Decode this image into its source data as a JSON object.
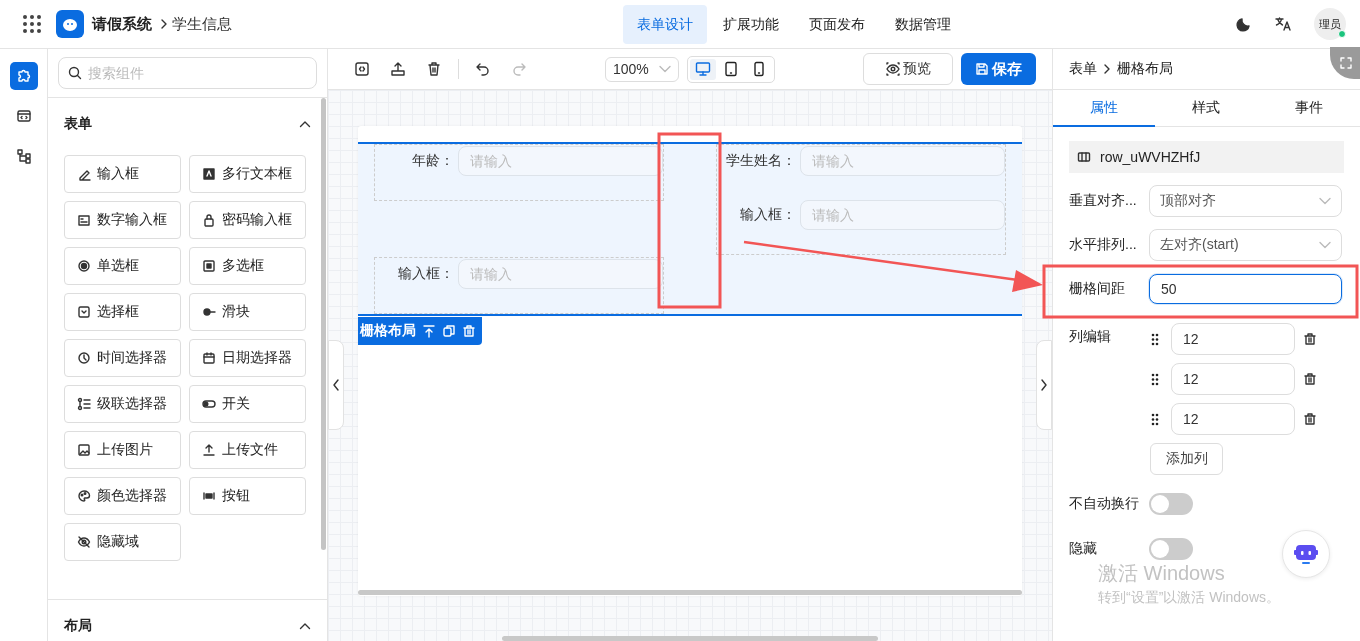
{
  "header": {
    "app_title": "请假系统",
    "breadcrumb": "学生信息",
    "tabs": [
      {
        "label": "表单设计",
        "selected": true
      },
      {
        "label": "扩展功能",
        "selected": false
      },
      {
        "label": "页面发布",
        "selected": false
      },
      {
        "label": "数据管理",
        "selected": false
      }
    ],
    "user": "理员"
  },
  "components": {
    "search": {
      "placeholder": "搜索组件"
    },
    "sections": [
      {
        "title": "表单",
        "expanded": true,
        "items": [
          {
            "label": "输入框"
          },
          {
            "label": "多行文本框"
          },
          {
            "label": "数字输入框"
          },
          {
            "label": "密码输入框"
          },
          {
            "label": "单选框"
          },
          {
            "label": "多选框"
          },
          {
            "label": "选择框"
          },
          {
            "label": "滑块"
          },
          {
            "label": "时间选择器"
          },
          {
            "label": "日期选择器"
          },
          {
            "label": "级联选择器"
          },
          {
            "label": "开关"
          },
          {
            "label": "上传图片"
          },
          {
            "label": "上传文件"
          },
          {
            "label": "颜色选择器"
          },
          {
            "label": "按钮"
          },
          {
            "label": "隐藏域"
          }
        ]
      },
      {
        "title": "布局",
        "expanded": true
      }
    ]
  },
  "toolbar": {
    "zoom": "100%",
    "devices": [
      {
        "kind": "desktop",
        "selected": true
      },
      {
        "kind": "tablet",
        "selected": false
      },
      {
        "kind": "phone",
        "selected": false
      }
    ],
    "preview": "预览",
    "save": "保存"
  },
  "canvas": {
    "grid": {
      "columns": [
        {
          "blocks": [
            {
              "fields": [
                {
                  "label": "年龄：",
                  "placeholder": "请输入"
                }
              ]
            },
            {
              "fields": [
                {
                  "label": "输入框：",
                  "placeholder": "请输入"
                }
              ]
            }
          ]
        },
        {
          "blocks": [
            {
              "fields": [
                {
                  "label": "学生姓名：",
                  "placeholder": "请输入"
                },
                {
                  "label": "输入框：",
                  "placeholder": "请输入"
                }
              ]
            }
          ]
        }
      ],
      "toolbar_label": "栅格布局"
    }
  },
  "properties": {
    "breadcrumb": [
      "表单",
      "栅格布局"
    ],
    "tabs": [
      {
        "label": "属性",
        "selected": true
      },
      {
        "label": "样式",
        "selected": false
      },
      {
        "label": "事件",
        "selected": false
      }
    ],
    "component_id": "row_uWVHZHfJ",
    "rows": [
      {
        "kind": "select",
        "label": "垂直对齐...",
        "value": "顶部对齐"
      },
      {
        "kind": "select",
        "label": "水平排列...",
        "value": "左对齐(start)"
      },
      {
        "kind": "input",
        "label": "栅格间距",
        "value": "50",
        "focused": true
      }
    ],
    "columns_label": "列编辑",
    "columns": [
      {
        "span": "12"
      },
      {
        "span": "12"
      },
      {
        "span": "12"
      }
    ],
    "add_column": "添加列",
    "switches": [
      {
        "label": "不自动换行",
        "on": false
      },
      {
        "label": "隐藏",
        "on": false
      }
    ]
  },
  "os_notice": {
    "title": "激活 Windows",
    "subtitle": "转到“设置”以激活 Windows。"
  }
}
